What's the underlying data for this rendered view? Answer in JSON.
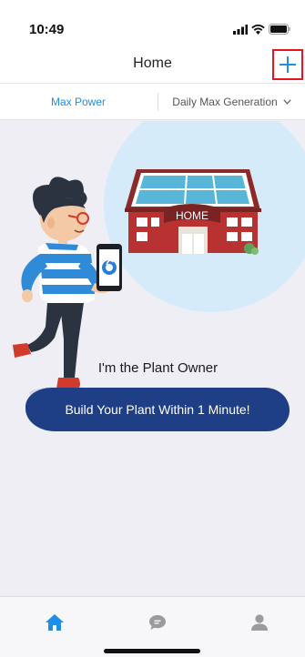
{
  "status": {
    "time": "10:49"
  },
  "nav": {
    "title": "Home",
    "add_icon": "plus-icon"
  },
  "tabs": {
    "left": "Max Power",
    "right": "Daily Max Generation"
  },
  "hero": {
    "house_sign": "HOME",
    "owner_text": "I'm the Plant Owner",
    "cta_label": "Build Your Plant Within 1 Minute!"
  },
  "tabbar": {
    "items": [
      {
        "icon": "home-icon",
        "active": true
      },
      {
        "icon": "chat-bubble-icon",
        "active": false
      },
      {
        "icon": "user-icon",
        "active": false
      }
    ]
  },
  "colors": {
    "accent": "#1f8fe5",
    "highlight": "#e8141b",
    "cta": "#1e3f86"
  }
}
